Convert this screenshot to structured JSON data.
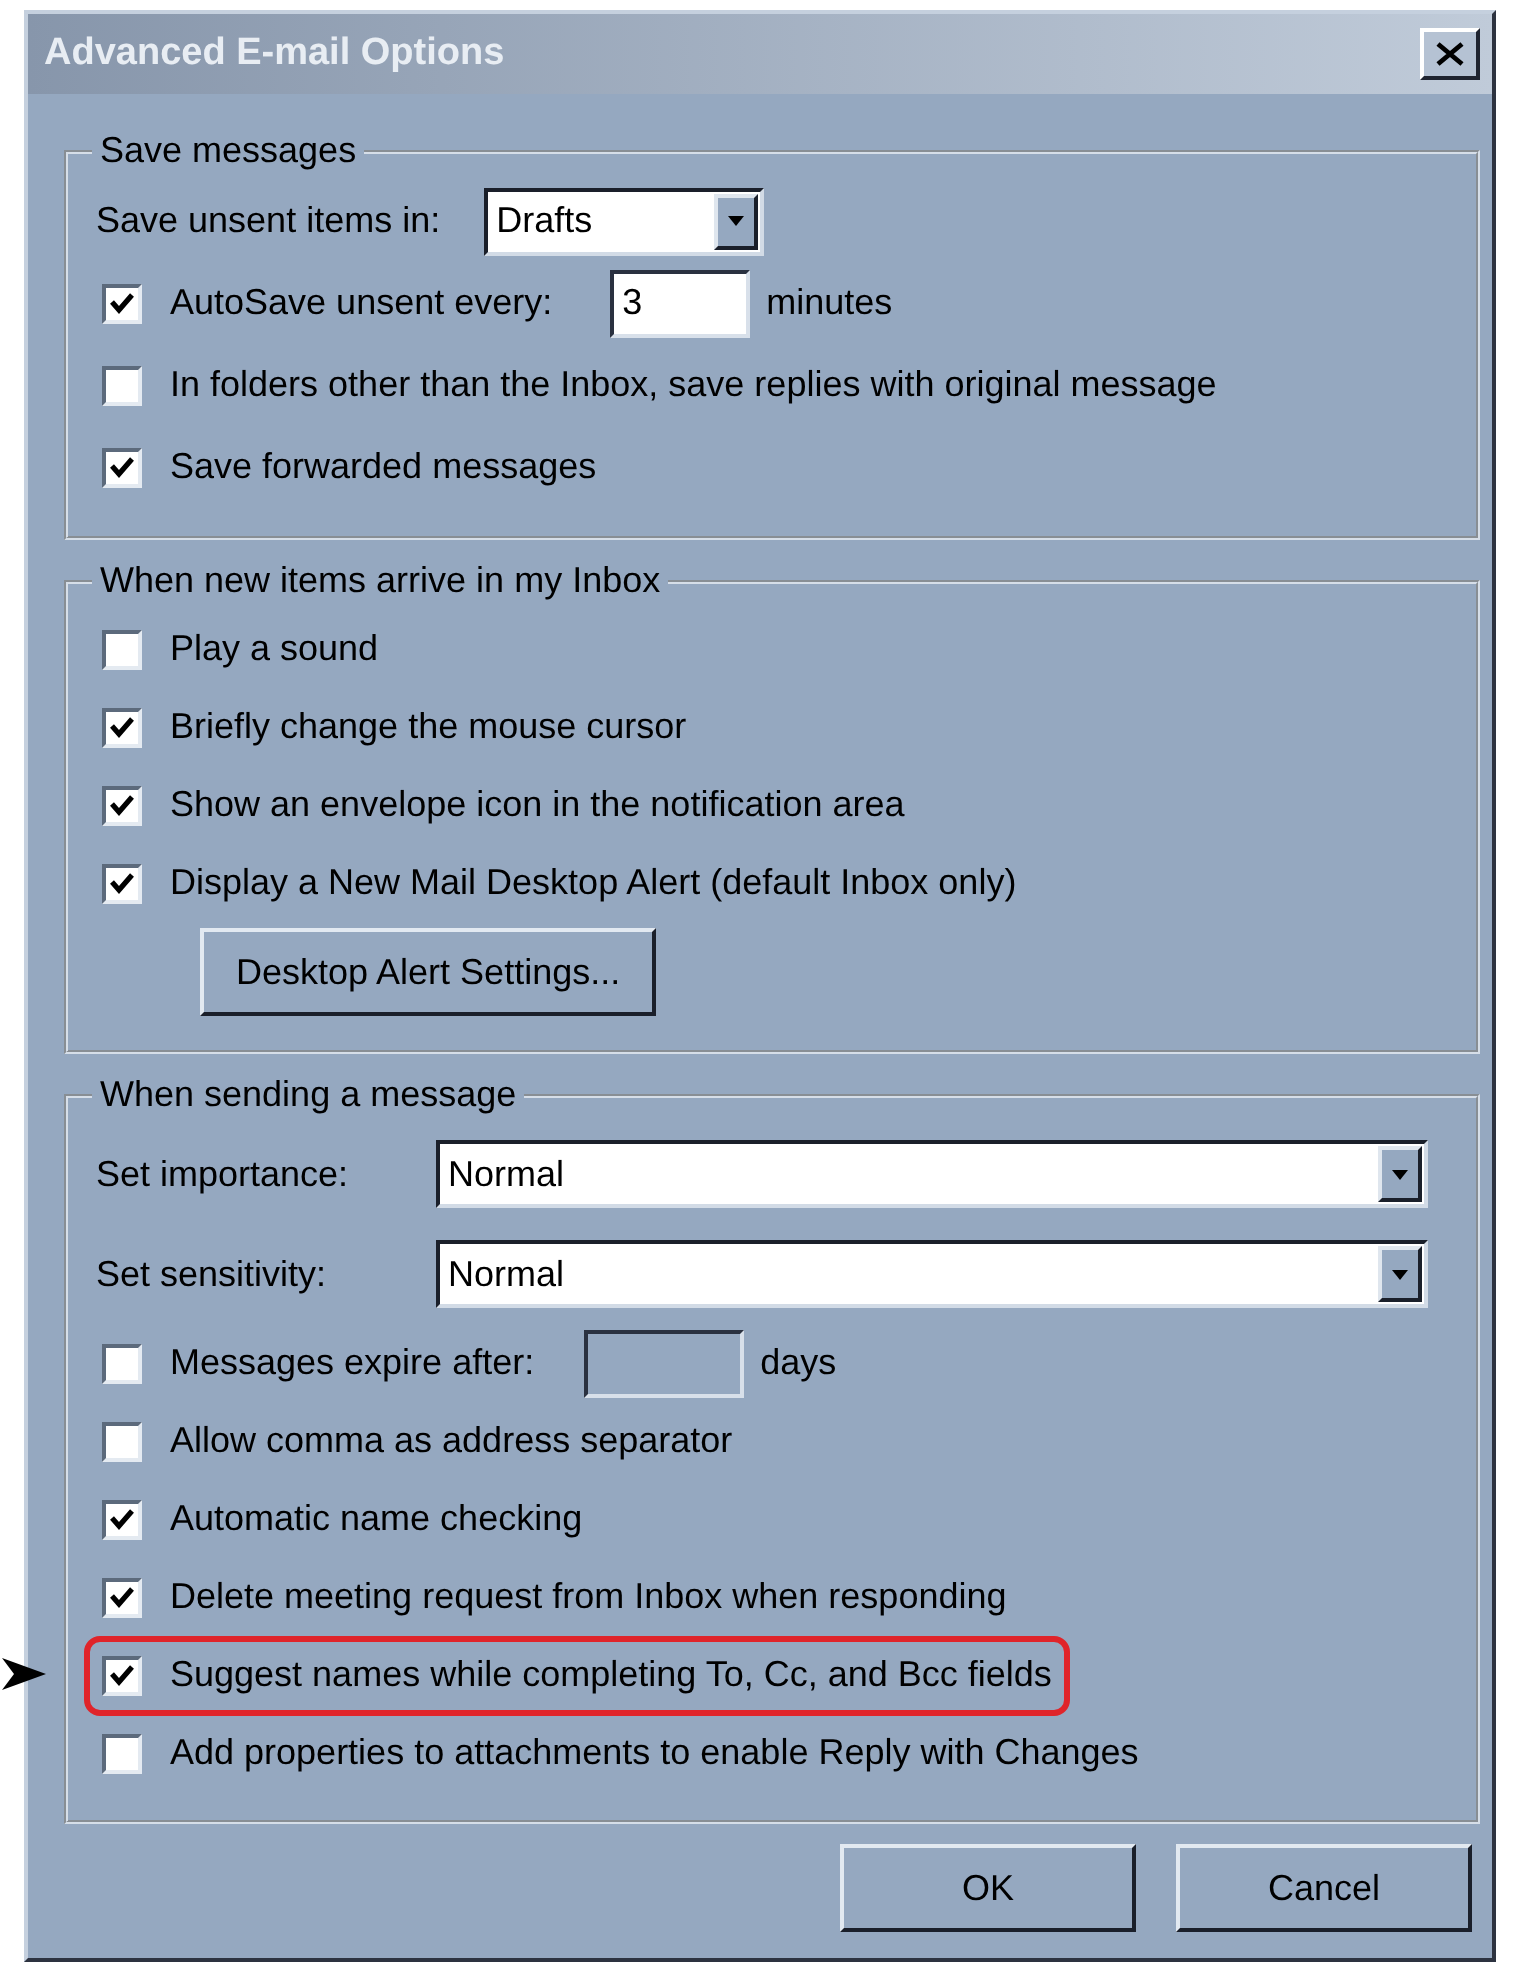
{
  "window": {
    "title": "Advanced E-mail Options"
  },
  "groups": [
    {
      "title": "Save messages",
      "items": [
        {
          "kind": "dropdown",
          "label": "Save unsent items in:",
          "value": "Drafts"
        },
        {
          "kind": "checkbox",
          "label": "AutoSave unsent every:",
          "checked": true,
          "field": {
            "value": "3",
            "disabled": false
          },
          "suffix": "minutes"
        },
        {
          "kind": "checkbox",
          "label": "In folders other than the Inbox, save replies with original message",
          "checked": false
        },
        {
          "kind": "checkbox",
          "label": "Save forwarded messages",
          "checked": true
        }
      ]
    },
    {
      "title": "When new items arrive in my Inbox",
      "items": [
        {
          "kind": "checkbox",
          "label": "Play a sound",
          "checked": false
        },
        {
          "kind": "checkbox",
          "label": "Briefly change the mouse cursor",
          "checked": true
        },
        {
          "kind": "checkbox",
          "label": "Show an envelope icon in the notification area",
          "checked": true
        },
        {
          "kind": "checkbox",
          "label": "Display a New Mail Desktop Alert (default Inbox only)",
          "checked": true
        },
        {
          "kind": "button",
          "label": "Desktop Alert Settings..."
        }
      ]
    },
    {
      "title": "When sending a message",
      "items": [
        {
          "kind": "dropdown",
          "label": "Set importance:",
          "value": "Normal"
        },
        {
          "kind": "dropdown",
          "label": "Set sensitivity:",
          "value": "Normal"
        },
        {
          "kind": "checkbox",
          "label": "Messages expire after:",
          "checked": false,
          "field": {
            "disabled": true
          },
          "suffix": "days"
        },
        {
          "kind": "checkbox",
          "label": "Allow comma as address separator",
          "checked": false
        },
        {
          "kind": "checkbox",
          "label": "Automatic name checking",
          "checked": true
        },
        {
          "kind": "checkbox",
          "label": "Delete meeting request from Inbox when responding",
          "checked": true
        },
        {
          "kind": "checkbox",
          "label": "Suggest names while completing To, Cc, and Bcc fields",
          "checked": true,
          "highlighted": true
        },
        {
          "kind": "checkbox",
          "label": "Add properties to attachments to enable Reply with Changes",
          "checked": false
        }
      ]
    }
  ],
  "buttons": [
    "OK",
    "Cancel"
  ]
}
